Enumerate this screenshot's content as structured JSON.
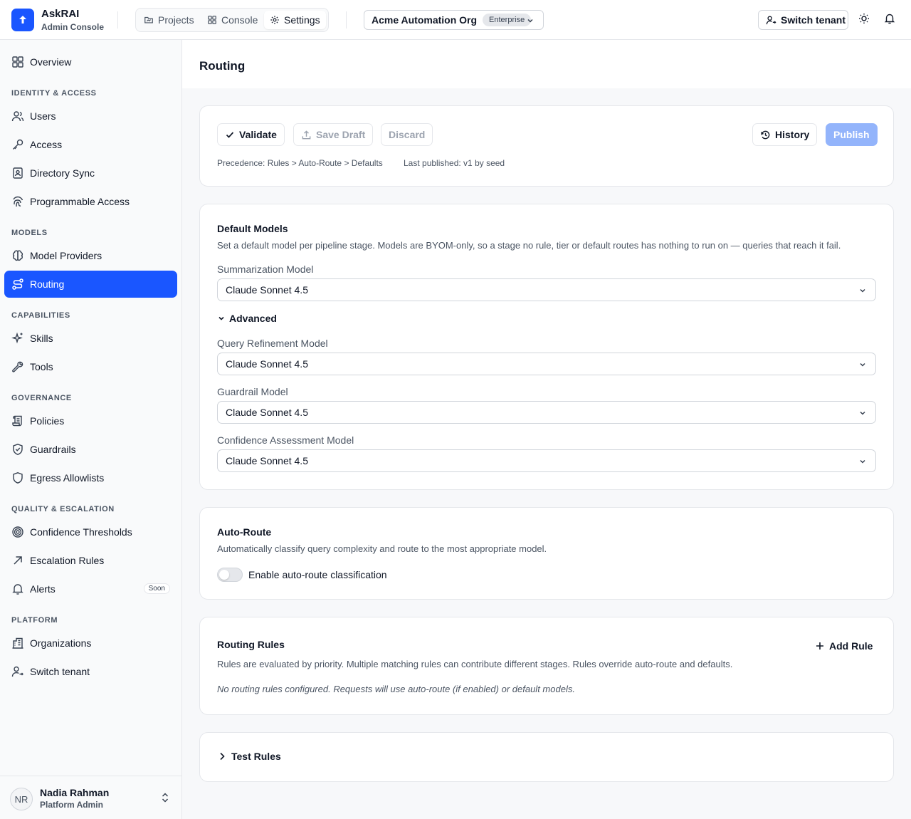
{
  "brand": {
    "name": "AskRAI",
    "subtitle": "Admin Console"
  },
  "topnav": {
    "tabs": [
      {
        "label": "Projects",
        "icon": "folder-icon"
      },
      {
        "label": "Console",
        "icon": "grid-icon"
      },
      {
        "label": "Settings",
        "icon": "gear-icon",
        "active": true
      }
    ],
    "org": {
      "name": "Acme Automation Org",
      "badge": "Enterprise"
    },
    "switch_tenant_label": "Switch tenant"
  },
  "sidebar": {
    "overview": "Overview",
    "sections": {
      "identity": "IDENTITY & ACCESS",
      "models": "MODELS",
      "capabilities": "CAPABILITIES",
      "governance": "GOVERNANCE",
      "quality": "QUALITY & ESCALATION",
      "platform": "PLATFORM"
    },
    "items": {
      "users": "Users",
      "access": "Access",
      "directory_sync": "Directory Sync",
      "programmable_access": "Programmable Access",
      "model_providers": "Model Providers",
      "routing": "Routing",
      "skills": "Skills",
      "tools": "Tools",
      "policies": "Policies",
      "guardrails": "Guardrails",
      "egress_allowlists": "Egress Allowlists",
      "confidence_thresholds": "Confidence Thresholds",
      "escalation_rules": "Escalation Rules",
      "alerts": "Alerts",
      "organizations": "Organizations",
      "switch_tenant": "Switch tenant"
    },
    "alerts_badge": "Soon",
    "user": {
      "initials": "NR",
      "name": "Nadia Rahman",
      "role": "Platform Admin"
    }
  },
  "page": {
    "title": "Routing"
  },
  "toolbar": {
    "validate": "Validate",
    "save_draft": "Save Draft",
    "discard": "Discard",
    "history": "History",
    "publish": "Publish",
    "precedence": "Precedence: Rules > Auto-Route > Defaults",
    "last_published": "Last published: v1 by seed"
  },
  "default_models": {
    "title": "Default Models",
    "description": "Set a default model per pipeline stage. Models are BYOM-only, so a stage no rule, tier or default routes has nothing to run on — queries that reach it fail.",
    "summarization": {
      "label": "Summarization Model",
      "value": "Claude Sonnet 4.5"
    },
    "advanced_label": "Advanced",
    "query_refinement": {
      "label": "Query Refinement Model",
      "value": "Claude Sonnet 4.5"
    },
    "guardrail": {
      "label": "Guardrail Model",
      "value": "Claude Sonnet 4.5"
    },
    "confidence": {
      "label": "Confidence Assessment Model",
      "value": "Claude Sonnet 4.5"
    }
  },
  "auto_route": {
    "title": "Auto-Route",
    "description": "Automatically classify query complexity and route to the most appropriate model.",
    "toggle_label": "Enable auto-route classification",
    "enabled": false
  },
  "routing_rules": {
    "title": "Routing Rules",
    "add_rule": "Add Rule",
    "description": "Rules are evaluated by priority. Multiple matching rules can contribute different stages. Rules override auto-route and defaults.",
    "empty": "No routing rules configured. Requests will use auto-route (if enabled) or default models."
  },
  "test_rules": {
    "label": "Test Rules"
  },
  "colors": {
    "accent": "#1a56ff",
    "publish_disabled": "#93b4fb"
  }
}
